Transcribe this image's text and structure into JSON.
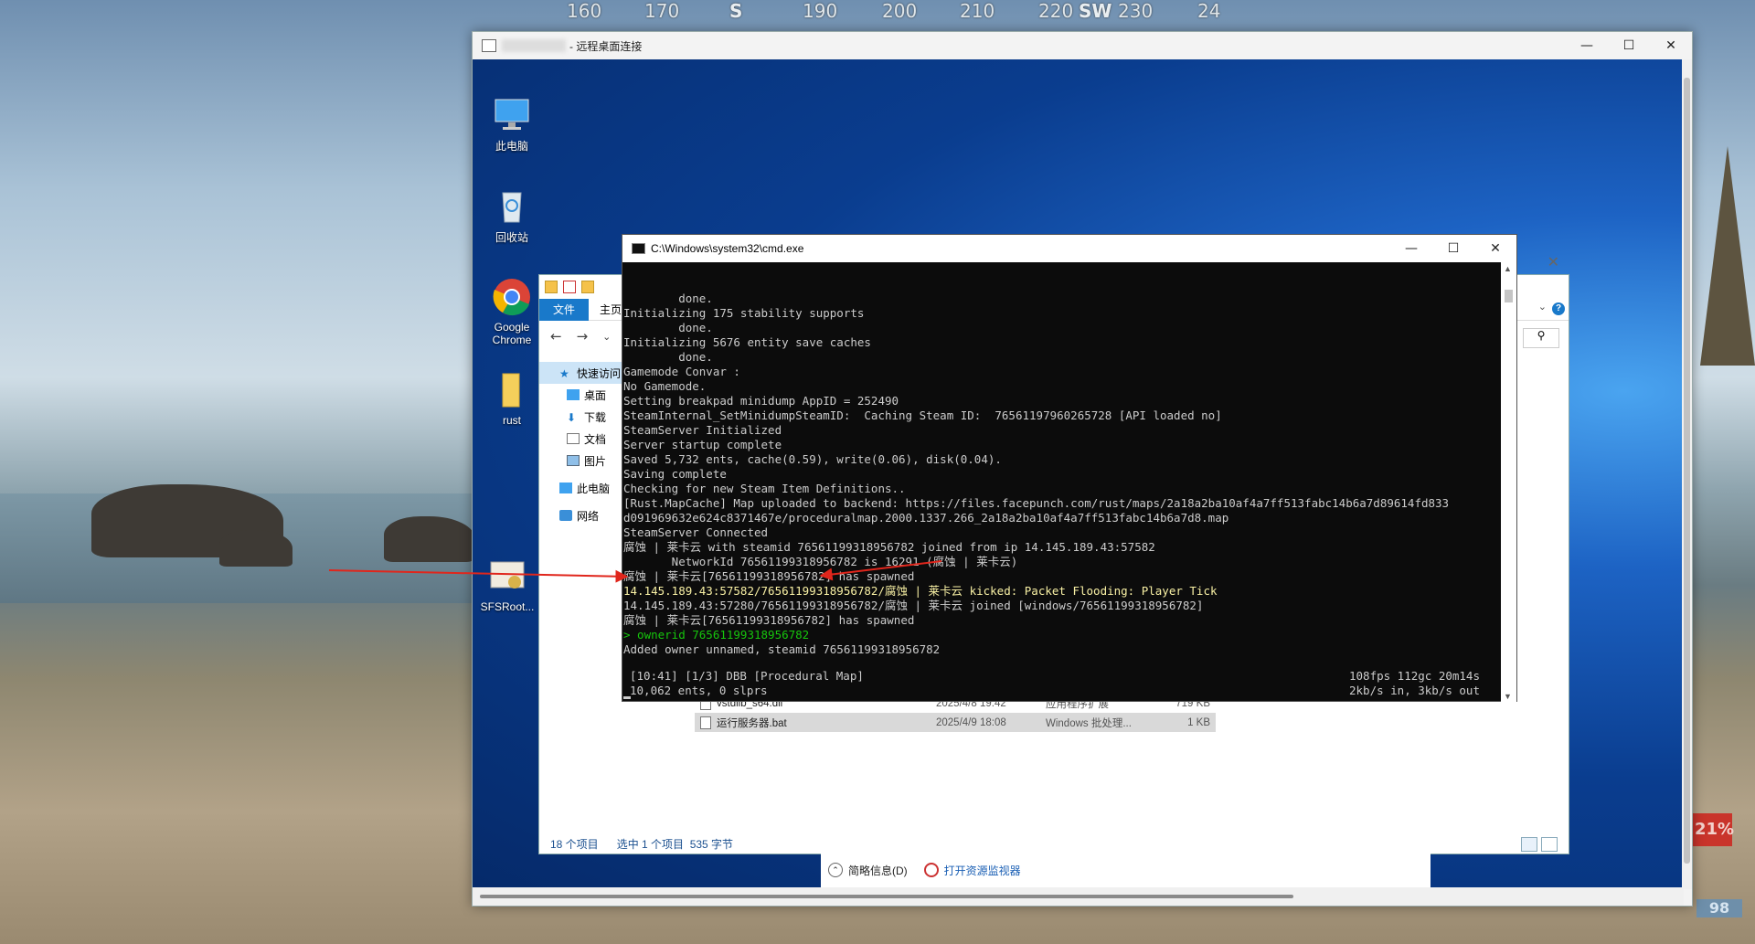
{
  "hud": {
    "compass": [
      {
        "label": "160",
        "kind": "tick"
      },
      {
        "label": "170",
        "kind": "tick"
      },
      {
        "label": "S",
        "kind": "dir"
      },
      {
        "label": "190",
        "kind": "tick"
      },
      {
        "label": "200",
        "kind": "tick"
      },
      {
        "label": "210",
        "kind": "tick"
      },
      {
        "label": "220",
        "kind": "tick"
      },
      {
        "label": "SW",
        "kind": "dir"
      },
      {
        "label": "230",
        "kind": "tick"
      },
      {
        "label": "24",
        "kind": "tick"
      }
    ],
    "percent_badge": "21%",
    "stat_badge": "98"
  },
  "rdp_window": {
    "title": "- 远程桌面连接",
    "controls": {
      "minimize": "—",
      "maximize": "☐",
      "close": "✕"
    }
  },
  "desktop_icons": [
    {
      "name": "this-pc",
      "label": "此电脑"
    },
    {
      "name": "recycle-bin",
      "label": "回收站"
    },
    {
      "name": "google-chrome",
      "label": "Google Chrome"
    },
    {
      "name": "rust",
      "label": "rust"
    },
    {
      "name": "sfsroot",
      "label": "SFSRoot..."
    }
  ],
  "explorer": {
    "tab_file": "文件",
    "tab_home": "主页",
    "nav": [
      {
        "name": "quick-access",
        "label": "快速访问"
      },
      {
        "name": "desktop",
        "label": "桌面"
      },
      {
        "name": "downloads",
        "label": "下载"
      },
      {
        "name": "documents",
        "label": "文档"
      },
      {
        "name": "pictures",
        "label": "图片"
      },
      {
        "name": "this-pc",
        "label": "此电脑"
      },
      {
        "name": "network",
        "label": "网络"
      }
    ],
    "files": [
      {
        "name": "vstdlib_s64.dll",
        "date": "2025/4/8 19:42",
        "type": "应用程序扩展",
        "size": "719 KB",
        "selected": false
      },
      {
        "name": "运行服务器.bat",
        "date": "2025/4/9 18:08",
        "type": "Windows 批处理...",
        "size": "1 KB",
        "selected": true
      }
    ],
    "status": {
      "count": "18 个项目",
      "selection": "选中 1 个项目  535 字节"
    }
  },
  "task_manager": {
    "fewer_details": "简略信息(D)",
    "open_resource_monitor": "打开资源监视器"
  },
  "cmd": {
    "title": "C:\\Windows\\system32\\cmd.exe",
    "lines": [
      {
        "text": "        done.",
        "color": "default"
      },
      {
        "text": "Initializing 175 stability supports",
        "color": "default"
      },
      {
        "text": "        done.",
        "color": "default"
      },
      {
        "text": "Initializing 5676 entity save caches",
        "color": "default"
      },
      {
        "text": "        done.",
        "color": "default"
      },
      {
        "text": "Gamemode Convar :",
        "color": "default"
      },
      {
        "text": "No Gamemode.",
        "color": "default"
      },
      {
        "text": "Setting breakpad minidump AppID = 252490",
        "color": "default"
      },
      {
        "text": "SteamInternal_SetMinidumpSteamID:  Caching Steam ID:  76561197960265728 [API loaded no]",
        "color": "default"
      },
      {
        "text": "SteamServer Initialized",
        "color": "default"
      },
      {
        "text": "Server startup complete",
        "color": "default"
      },
      {
        "text": "Saved 5,732 ents, cache(0.59), write(0.06), disk(0.04).",
        "color": "default"
      },
      {
        "text": "Saving complete",
        "color": "default"
      },
      {
        "text": "Checking for new Steam Item Definitions..",
        "color": "default"
      },
      {
        "text": "[Rust.MapCache] Map uploaded to backend: https://files.facepunch.com/rust/maps/2a18a2ba10af4a7ff513fabc14b6a7d89614fd833",
        "color": "default"
      },
      {
        "text": "d091969632e624c8371467e/proceduralmap.2000.1337.266_2a18a2ba10af4a7ff513fabc14b6a7d8.map",
        "color": "default"
      },
      {
        "text": "SteamServer Connected",
        "color": "default"
      },
      {
        "text": "腐蚀 | 莱卡云 with steamid 76561199318956782 joined from ip 14.145.189.43:57582",
        "color": "default"
      },
      {
        "text": "       NetworkId 76561199318956782 is 16291 (腐蚀 | 莱卡云)",
        "color": "default"
      },
      {
        "text": "腐蚀 | 莱卡云[76561199318956782] has spawned",
        "color": "default"
      },
      {
        "text": "14.145.189.43:57582/76561199318956782/腐蚀 | 莱卡云 kicked: Packet Flooding: Player Tick",
        "color": "yellow"
      },
      {
        "text": "14.145.189.43:57280/76561199318956782/腐蚀 | 莱卡云 joined [windows/76561199318956782]",
        "color": "default"
      },
      {
        "text": "腐蚀 | 莱卡云[76561199318956782] has spawned",
        "color": "default"
      },
      {
        "text": "> ownerid 76561199318956782",
        "color": "green"
      },
      {
        "text": "Added owner unnamed, steamid 76561199318956782",
        "color": "default"
      }
    ],
    "status_left": "[10:41] [1/3] DBB [Procedural Map]\n10,062 ents, 0 slprs",
    "status_right": "108fps 112gc 20m14s\n2kb/s in, 3kb/s out"
  },
  "colors": {
    "cmd_bg": "#0c0c0c",
    "cmd_text": "#cccccc",
    "cmd_yellow": "#f9f1a5",
    "cmd_green": "#16c60c",
    "arrow_red": "#e0261c",
    "explorer_accent": "#1979ca"
  }
}
